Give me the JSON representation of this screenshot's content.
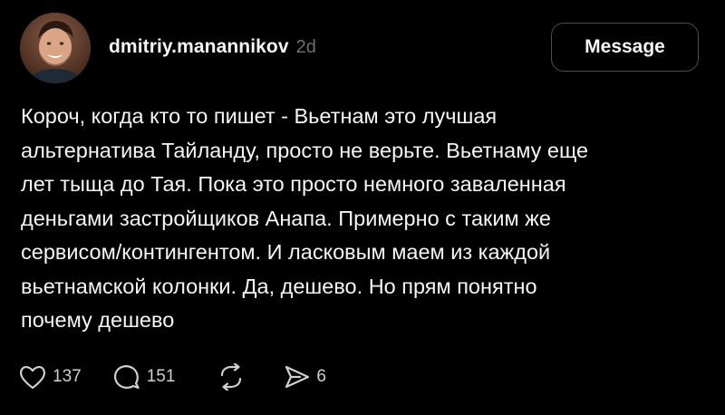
{
  "post": {
    "author": {
      "username": "dmitriy.manannikov",
      "avatar_icon": "user-avatar-photo"
    },
    "timestamp": "2d",
    "message_button_label": "Message",
    "text": "Короч, когда кто то пишет - Вьетнам это лучшая\nальтернатива Тайланду, просто не верьте. Вьетнаму еще\nлет тыща до Тая. Пока это просто немного заваленная\nденьгами застройщиков Анапа. Примерно с таким же\nсервисом/контингентом. И ласковым маем из каждой\nвьетнамской колонки. Да, дешево. Но прям понятно\nпочему дешево",
    "actions": {
      "likes": "137",
      "replies": "151",
      "shares": "6"
    }
  },
  "colors": {
    "background": "#000000",
    "text": "#f3f5f7",
    "muted": "#6f6f6f",
    "border": "#4d4d4d"
  }
}
